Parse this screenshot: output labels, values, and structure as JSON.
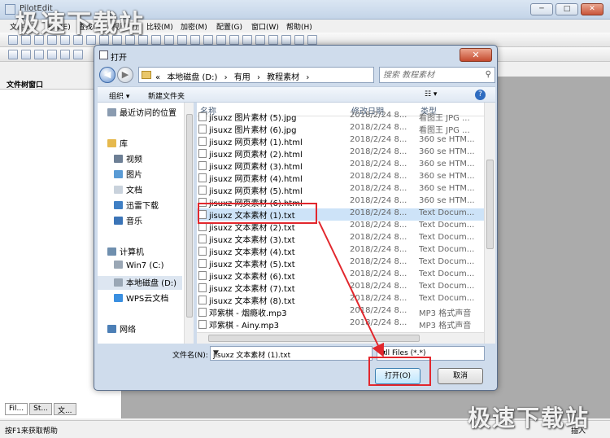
{
  "app": {
    "title": "PilotEdit",
    "window_controls": [
      "─",
      "□",
      "✕"
    ],
    "menu": [
      "文件(F)",
      "编辑(E)",
      "查找(S)",
      "视图(V)",
      "比较(M)",
      "加密(M)",
      "配置(G)",
      "窗口(W)",
      "帮助(H)"
    ],
    "side_panel_title": "文件树窗口",
    "side_tabs": [
      "Fil...",
      "St...",
      "文..."
    ],
    "status_text": "按F1来获取帮助",
    "status_mode": "插入"
  },
  "watermark": "极速下载站",
  "dialog": {
    "title": "打开",
    "close_label": "✕",
    "back_label": "◀",
    "forward_label": "▶",
    "address": [
      "«",
      "本地磁盘 (D:)",
      "›",
      "有用",
      "›",
      "教程素材",
      "›"
    ],
    "search_placeholder": "搜索 教程素材",
    "command_bar": {
      "organize": "组织 ▾",
      "new_folder": "新建文件夹",
      "view": "☷ ▾",
      "help": "?"
    },
    "nav_items": [
      {
        "label": "最近访问的位置",
        "icon": "recent-places-icon",
        "color": "#8a9bb0"
      },
      {
        "label": "",
        "icon": "",
        "color": ""
      },
      {
        "label": "库",
        "icon": "library-icon",
        "color": "#e6b94d"
      },
      {
        "label": "视频",
        "icon": "video-icon",
        "color": "#6d7f95"
      },
      {
        "label": "图片",
        "icon": "pictures-icon",
        "color": "#5a9bd5"
      },
      {
        "label": "文档",
        "icon": "documents-icon",
        "color": "#c9d2dc"
      },
      {
        "label": "迅雷下载",
        "icon": "download-icon",
        "color": "#3f7fc4"
      },
      {
        "label": "音乐",
        "icon": "music-icon",
        "color": "#3b74b7"
      },
      {
        "label": "",
        "icon": "",
        "color": ""
      },
      {
        "label": "计算机",
        "icon": "computer-icon",
        "color": "#6f8fae"
      },
      {
        "label": "Win7 (C:)",
        "icon": "drive-icon",
        "color": "#9aa7b5"
      },
      {
        "label": "本地磁盘 (D:)",
        "icon": "drive-icon",
        "color": "#9aa7b5"
      },
      {
        "label": "WPS云文档",
        "icon": "cloud-icon",
        "color": "#3a8fe0"
      },
      {
        "label": "",
        "icon": "",
        "color": ""
      },
      {
        "label": "网络",
        "icon": "network-icon",
        "color": "#4c7fb6"
      }
    ],
    "columns": [
      "名称",
      "修改日期",
      "类型"
    ],
    "files": [
      {
        "name": "jisuxz 图片素材 (5).jpg",
        "date": "2018/2/24 8...",
        "type": "看图王 JPG ...",
        "icon": "jpg-file-icon"
      },
      {
        "name": "jisuxz 图片素材 (6).jpg",
        "date": "2018/2/24 8...",
        "type": "看图王 JPG ...",
        "icon": "jpg-file-icon"
      },
      {
        "name": "jisuxz 网页素材 (1).html",
        "date": "2018/2/24 8...",
        "type": "360 se HTM...",
        "icon": "html-file-icon"
      },
      {
        "name": "jisuxz 网页素材 (2).html",
        "date": "2018/2/24 8...",
        "type": "360 se HTM...",
        "icon": "html-file-icon"
      },
      {
        "name": "jisuxz 网页素材 (3).html",
        "date": "2018/2/24 8...",
        "type": "360 se HTM...",
        "icon": "html-file-icon"
      },
      {
        "name": "jisuxz 网页素材 (4).html",
        "date": "2018/2/24 8...",
        "type": "360 se HTM...",
        "icon": "html-file-icon"
      },
      {
        "name": "jisuxz 网页素材 (5).html",
        "date": "2018/2/24 8...",
        "type": "360 se HTM...",
        "icon": "html-file-icon"
      },
      {
        "name": "jisuxz 网页素材 (6).html",
        "date": "2018/2/24 8...",
        "type": "360 se HTM...",
        "icon": "html-file-icon"
      },
      {
        "name": "jisuxz 文本素材 (1).txt",
        "date": "2018/2/24 8...",
        "type": "Text Docum...",
        "icon": "txt-file-icon",
        "selected": true
      },
      {
        "name": "jisuxz 文本素材 (2).txt",
        "date": "2018/2/24 8...",
        "type": "Text Docum...",
        "icon": "txt-file-icon"
      },
      {
        "name": "jisuxz 文本素材 (3).txt",
        "date": "2018/2/24 8...",
        "type": "Text Docum...",
        "icon": "txt-file-icon"
      },
      {
        "name": "jisuxz 文本素材 (4).txt",
        "date": "2018/2/24 8...",
        "type": "Text Docum...",
        "icon": "txt-file-icon"
      },
      {
        "name": "jisuxz 文本素材 (5).txt",
        "date": "2018/2/24 8...",
        "type": "Text Docum...",
        "icon": "txt-file-icon"
      },
      {
        "name": "jisuxz 文本素材 (6).txt",
        "date": "2018/2/24 8...",
        "type": "Text Docum...",
        "icon": "txt-file-icon"
      },
      {
        "name": "jisuxz 文本素材 (7).txt",
        "date": "2018/2/24 8...",
        "type": "Text Docum...",
        "icon": "txt-file-icon"
      },
      {
        "name": "jisuxz 文本素材 (8).txt",
        "date": "2018/2/24 8...",
        "type": "Text Docum...",
        "icon": "txt-file-icon"
      },
      {
        "name": "邓紫棋 - 烟瘾收.mp3",
        "date": "2018/2/24 8...",
        "type": "MP3 格式声音",
        "icon": "mp3-file-icon"
      },
      {
        "name": "邓紫棋 - Ainy.mp3",
        "date": "2018/2/24 8...",
        "type": "MP3 格式声音",
        "icon": "mp3-file-icon"
      }
    ],
    "filename_label": "文件名(N):",
    "filename_value": "jisuxz 文本素材 (1).txt",
    "filter_value": "All Files (*.*)",
    "open_label": "打开(O)",
    "cancel_label": "取消",
    "highlight_color": "#e2272d"
  }
}
